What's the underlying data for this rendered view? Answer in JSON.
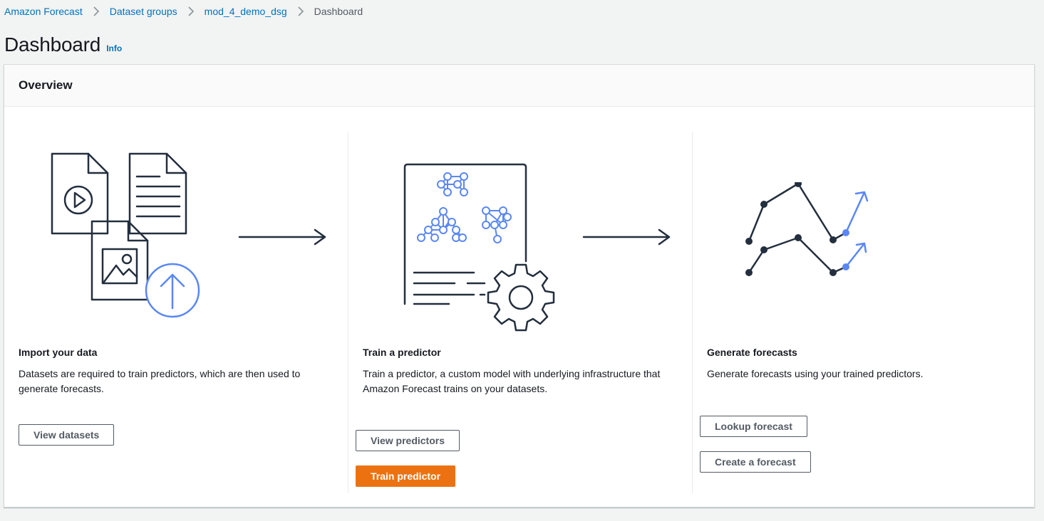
{
  "breadcrumb": {
    "items": [
      "Amazon Forecast",
      "Dataset groups",
      "mod_4_demo_dsg"
    ],
    "current": "Dashboard"
  },
  "page": {
    "title": "Dashboard",
    "info_label": "Info"
  },
  "overview": {
    "title": "Overview",
    "steps": [
      {
        "title": "Import your data",
        "description": "Datasets are required to train predictors, which are then used to generate forecasts.",
        "buttons": [
          "View datasets"
        ]
      },
      {
        "title": "Train a predictor",
        "description": "Train a predictor, a custom model with underlying infrastructure that Amazon Forecast trains on your datasets.",
        "buttons": [
          "View predictors",
          "Train predictor"
        ]
      },
      {
        "title": "Generate forecasts",
        "description": "Generate forecasts using your trained predictors.",
        "buttons": [
          "Lookup forecast",
          "Create a forecast"
        ]
      }
    ]
  },
  "colors": {
    "link": "#0073bb",
    "primary_button": "#ec7211",
    "illustration_dark": "#232f3e",
    "illustration_accent": "#5a87f5"
  },
  "icons": {
    "breadcrumb_separator": "chevron-right-icon",
    "step1": "import-data-illustration",
    "step2": "train-predictor-illustration",
    "step3": "generate-forecasts-illustration",
    "flow_arrow": "arrow-right-icon"
  }
}
